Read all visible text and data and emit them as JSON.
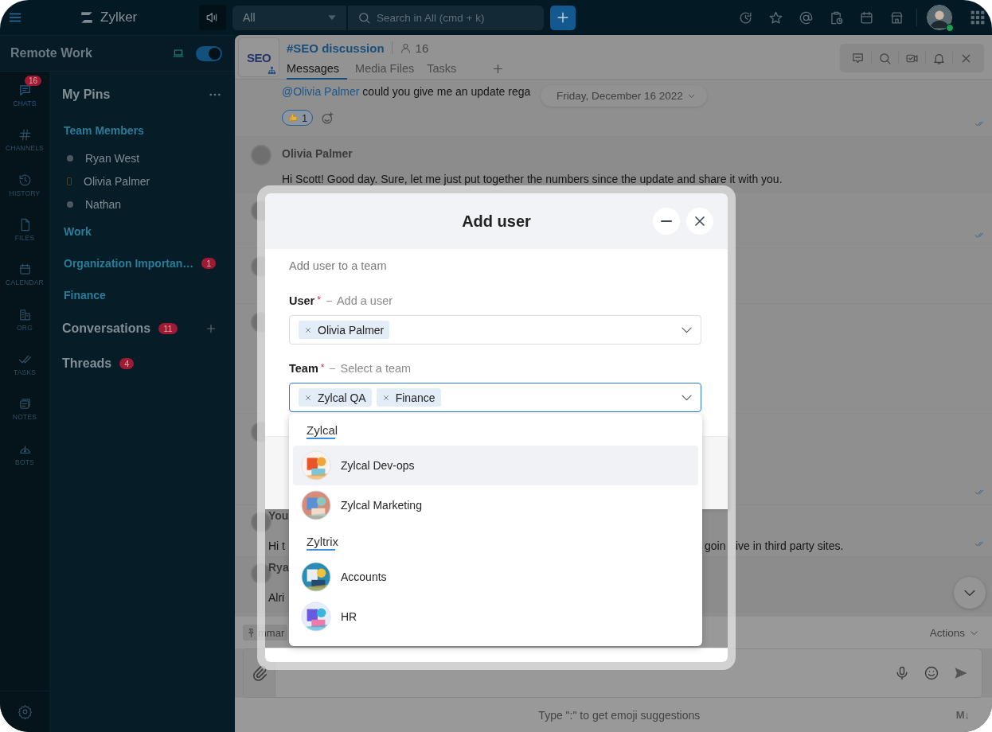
{
  "topbar": {
    "app_name": "Zylker",
    "scope": "All",
    "search_placeholder": "Search in All (cmd + k)",
    "user_online": true
  },
  "workspace": {
    "name": "Remote Work",
    "toggle_on": true
  },
  "rail": [
    {
      "kind": "chats",
      "label": "CHATS",
      "badge": "16",
      "selected": true
    },
    {
      "kind": "channels",
      "label": "CHANNELS",
      "selected": false
    },
    {
      "kind": "history",
      "label": "HISTORY",
      "selected": false
    },
    {
      "kind": "files",
      "label": "FILES",
      "selected": false
    },
    {
      "kind": "calendar",
      "label": "CALENDAR",
      "selected": false
    },
    {
      "kind": "org",
      "label": "ORG",
      "selected": false
    },
    {
      "kind": "tasks",
      "label": "TASKS",
      "selected": false
    },
    {
      "kind": "notes",
      "label": "NOTES",
      "selected": false
    },
    {
      "kind": "bots",
      "label": "BOTS",
      "selected": false
    }
  ],
  "pins": {
    "title": "My Pins",
    "groups": [
      {
        "title": "Team Members",
        "members": [
          {
            "name": "Ryan West",
            "kind": "dot"
          },
          {
            "name": "Olivia Palmer",
            "kind": "mobile"
          },
          {
            "name": "Nathan",
            "kind": "dot"
          }
        ]
      },
      {
        "title": "Work"
      },
      {
        "title": "Organization Importan…",
        "badge": "1"
      },
      {
        "title": "Finance"
      }
    ]
  },
  "sections": [
    {
      "title": "Conversations",
      "badge": "11",
      "addable": true
    },
    {
      "title": "Threads",
      "badge": "4"
    }
  ],
  "channel": {
    "logo_text": "SEO",
    "name": "#SEO discussion",
    "members": "16",
    "tabs": [
      {
        "label": "Messages",
        "selected": true
      },
      {
        "label": "Media Files",
        "selected": false
      },
      {
        "label": "Tasks",
        "selected": false
      }
    ]
  },
  "date_pill": "Friday, December 16 2022",
  "messages": [
    {
      "kind": "mention",
      "mention": "@Olivia Palmer",
      "text": "could you give me an update rega",
      "reaction_count": "1",
      "read": true
    },
    {
      "kind": "post",
      "author": "Olivia Palmer",
      "text": "Hi Scott! Good day. Sure, let me just put together the numbers since the update and share it with you."
    },
    {
      "kind": "avatar_only",
      "read": true
    },
    {
      "kind": "avatar_only"
    },
    {
      "kind": "avatar_only"
    },
    {
      "kind": "avatar_only",
      "read": true
    },
    {
      "kind": "partial",
      "author": "You",
      "pieces": [
        "Hi t",
        "goin",
        "ive in third party sites."
      ],
      "read": true
    },
    {
      "kind": "partial",
      "author": "Rya",
      "pieces": [
        "Alri"
      ]
    }
  ],
  "composer": {
    "chip": "mmar",
    "actions": "Actions",
    "hint": "Type \":\" to get emoji suggestions",
    "markdown": "M↓"
  },
  "modal": {
    "title": "Add user",
    "subtitle": "Add user to a team",
    "fields": [
      {
        "label": "User",
        "required_mark": "*",
        "hint": "Add a user",
        "chips": [
          "Olivia Palmer"
        ],
        "focused": false
      },
      {
        "label": "Team",
        "required_mark": "*",
        "hint": "Select a team",
        "chips": [
          "Zylcal QA",
          "Finance"
        ],
        "focused": true
      }
    ],
    "dropdown": [
      {
        "title": "Zylcal",
        "options": [
          {
            "name": "Zylcal Dev-ops",
            "selected": true
          },
          {
            "name": "Zylcal Marketing",
            "selected": false
          }
        ]
      },
      {
        "title": "Zyltrix",
        "options": [
          {
            "name": "Accounts",
            "selected": false
          },
          {
            "name": "HR",
            "selected": false
          }
        ]
      }
    ]
  }
}
